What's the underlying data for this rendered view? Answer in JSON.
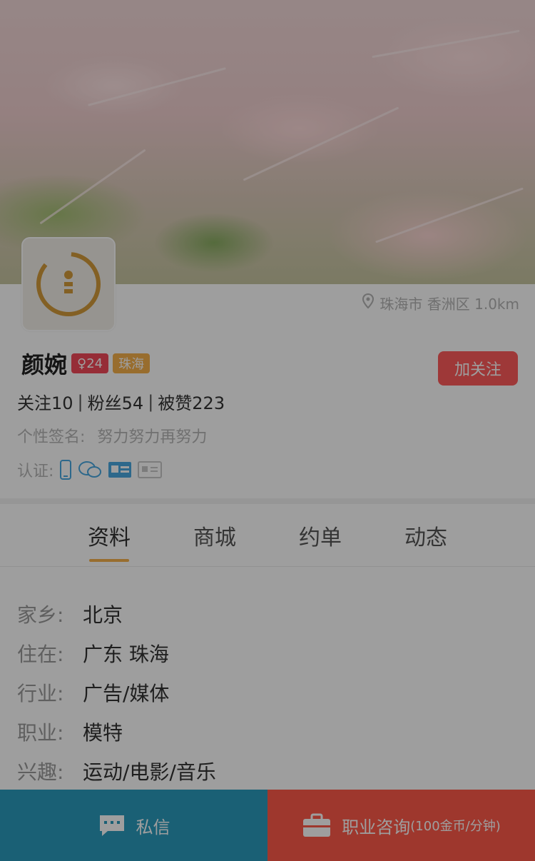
{
  "profile": {
    "name": "颜婉",
    "gender_age_badge": "♀24",
    "city_badge": "珠海",
    "follow_button": "加关注",
    "location": "珠海市 香洲区 1.0km",
    "stats": {
      "following": "关注10",
      "fans": "粉丝54",
      "likes": "被赞223"
    },
    "signature_label": "个性签名:",
    "signature": "努力努力再努力",
    "verify_label": "认证:"
  },
  "tabs": [
    {
      "label": "资料"
    },
    {
      "label": "商城"
    },
    {
      "label": "约单"
    },
    {
      "label": "动态"
    }
  ],
  "info": [
    {
      "k": "家乡:",
      "v": "北京"
    },
    {
      "k": "住在:",
      "v": "广东 珠海"
    },
    {
      "k": "行业:",
      "v": "广告/媒体"
    },
    {
      "k": "职业:",
      "v": "模特"
    },
    {
      "k": "兴趣:",
      "v": "运动/电影/音乐"
    }
  ],
  "bottom": {
    "message": "私信",
    "consult": "职业咨询",
    "consult_sub": "(100金币/分钟)"
  },
  "colors": {
    "accent_orange": "#f6b04b",
    "follow_red": "#ff5b5b",
    "message_blue": "#2a9bbd",
    "consult_red": "#ff5a4a"
  }
}
